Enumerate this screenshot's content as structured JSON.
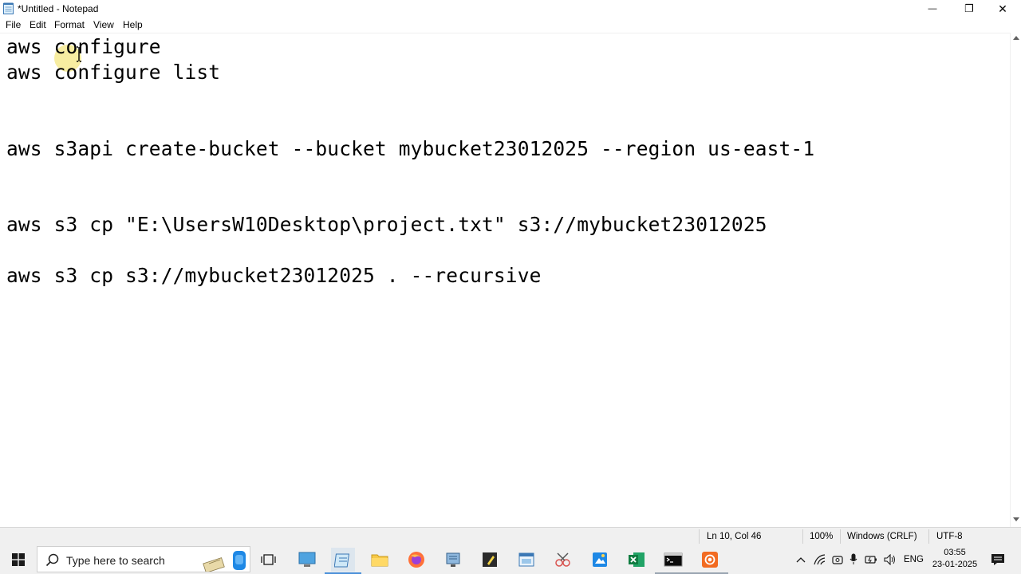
{
  "window": {
    "title": "*Untitled - Notepad",
    "minimize_glyph": "—",
    "restore_glyph": "❐",
    "close_glyph": "✕"
  },
  "menu": [
    "File",
    "Edit",
    "Format",
    "View",
    "Help"
  ],
  "editor": {
    "lines": [
      "aws configure",
      "aws configure list",
      "aws s3api create-bucket --bucket mybucket23012025 --region us-east-1",
      "aws s3 cp \"E:\\UsersW10Desktop\\project.txt\" s3://mybucket23012025",
      "aws s3 cp s3://mybucket23012025 . --recursive"
    ]
  },
  "status": {
    "position": "Ln 10, Col 46",
    "zoom": "100%",
    "line_ending": "Windows (CRLF)",
    "encoding": "UTF-8"
  },
  "taskbar": {
    "search_placeholder": "Type here to search",
    "language": "ENG",
    "time": "03:55",
    "date": "23-01-2025"
  },
  "colors": {
    "editor_bg": "#ffffff",
    "statusbar_bg": "#f0f0f0",
    "taskbar_bg": "#f0f0f0",
    "cursor_highlight": "#f5e88a",
    "active_indicator": "#4a90d9"
  }
}
